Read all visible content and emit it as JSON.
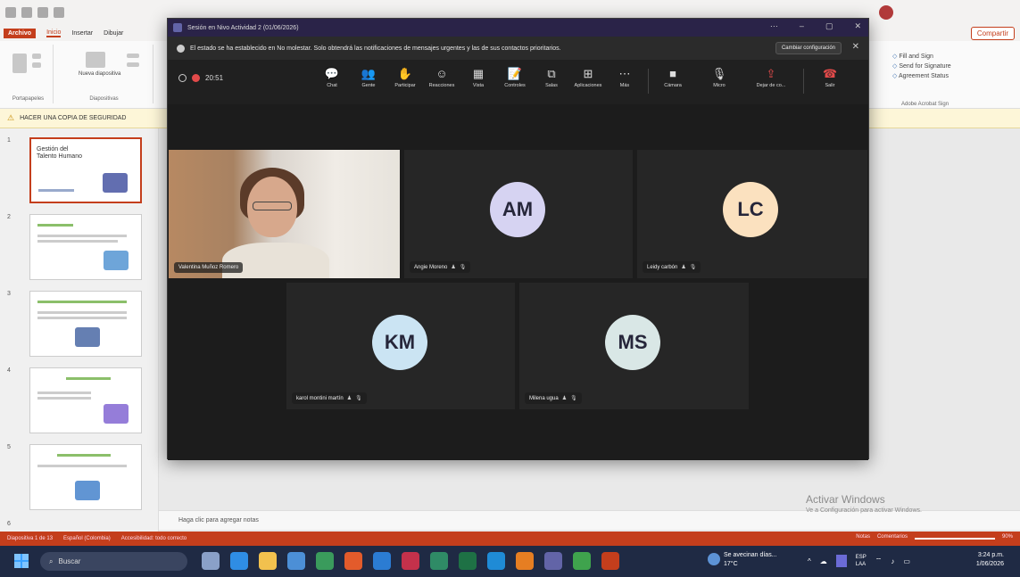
{
  "ppt": {
    "tabs": [
      "Archivo",
      "Inicio",
      "Insertar",
      "Dibujar"
    ],
    "share_label": "Compartir",
    "ribbon_groups": [
      "Portapapeles",
      "Diapositivas"
    ],
    "ribbon_new_slide": "Nueva diapositiva",
    "acrobat_items": [
      "Fill and Sign",
      "Send for Signature",
      "Agreement Status"
    ],
    "acrobat_group": "Adobe Acrobat Sign",
    "warning_text": "HACER UNA COPIA DE SEGURIDAD",
    "slides": [
      {
        "num": "1",
        "title": "Gestión del Talento Humano"
      },
      {
        "num": "2",
        "title": ""
      },
      {
        "num": "3",
        "title": ""
      },
      {
        "num": "4",
        "title": ""
      },
      {
        "num": "5",
        "title": ""
      },
      {
        "num": "6",
        "title": ""
      }
    ],
    "notes_placeholder": "Haga clic para agregar notas",
    "activate_title": "Activar Windows",
    "activate_sub": "Ve a Configuración para activar Windows.",
    "status_left": [
      "Diapositiva 1 de 13",
      "Español (Colombia)",
      "Accesibilidad: todo correcto"
    ],
    "status_right": [
      "Notas",
      "Comentarios"
    ],
    "zoom": "90%"
  },
  "teams": {
    "window_title": "Sesión en Nivo Actividad 2 (01/06/2026)",
    "notice_text": "El estado se ha establecido en No molestar. Solo obtendrá las notificaciones de mensajes urgentes y las de sus contactos prioritarios.",
    "notice_button": "Cambiar configuración",
    "timer": "20:51",
    "toolbar": [
      {
        "icon": "chat-icon",
        "glyph": "💬",
        "label": "Chat"
      },
      {
        "icon": "people-icon",
        "glyph": "👥",
        "label": "Gente"
      },
      {
        "icon": "raise-hand-icon",
        "glyph": "✋",
        "label": "Participar"
      },
      {
        "icon": "reactions-icon",
        "glyph": "☺",
        "label": "Reacciones"
      },
      {
        "icon": "view-icon",
        "glyph": "▦",
        "label": "Vista"
      },
      {
        "icon": "notes-icon",
        "glyph": "📝",
        "label": "Controles"
      },
      {
        "icon": "rooms-icon",
        "glyph": "⧉",
        "label": "Salas"
      },
      {
        "icon": "apps-icon",
        "glyph": "⊞",
        "label": "Aplicaciones"
      },
      {
        "icon": "more-icon",
        "glyph": "⋯",
        "label": "Más"
      }
    ],
    "camera_label": "Cámara",
    "mic_label": "Micro",
    "share_label": "Dejar de co...",
    "leave_label": "Salir",
    "participants": [
      {
        "name": "Valentina Muñoz Romero",
        "initials": "",
        "avatar_color": ""
      },
      {
        "name": "Angie Moreno",
        "initials": "AM",
        "avatar_color": "#d6d3f2"
      },
      {
        "name": "Leidy carbón",
        "initials": "LC",
        "avatar_color": "#fbe1bf"
      },
      {
        "name": "karol montini martín",
        "initials": "KM",
        "avatar_color": "#cbe4f3"
      },
      {
        "name": "Milena ugua",
        "initials": "MS",
        "avatar_color": "#d9e7e6"
      }
    ]
  },
  "taskbar": {
    "search_placeholder": "Buscar",
    "weather_line1": "Se avecinan días...",
    "weather_line2": "17°C",
    "lang_line1": "ESP",
    "lang_line2": "LAA",
    "time": "3:24 p.m.",
    "date": "1/06/2026"
  }
}
